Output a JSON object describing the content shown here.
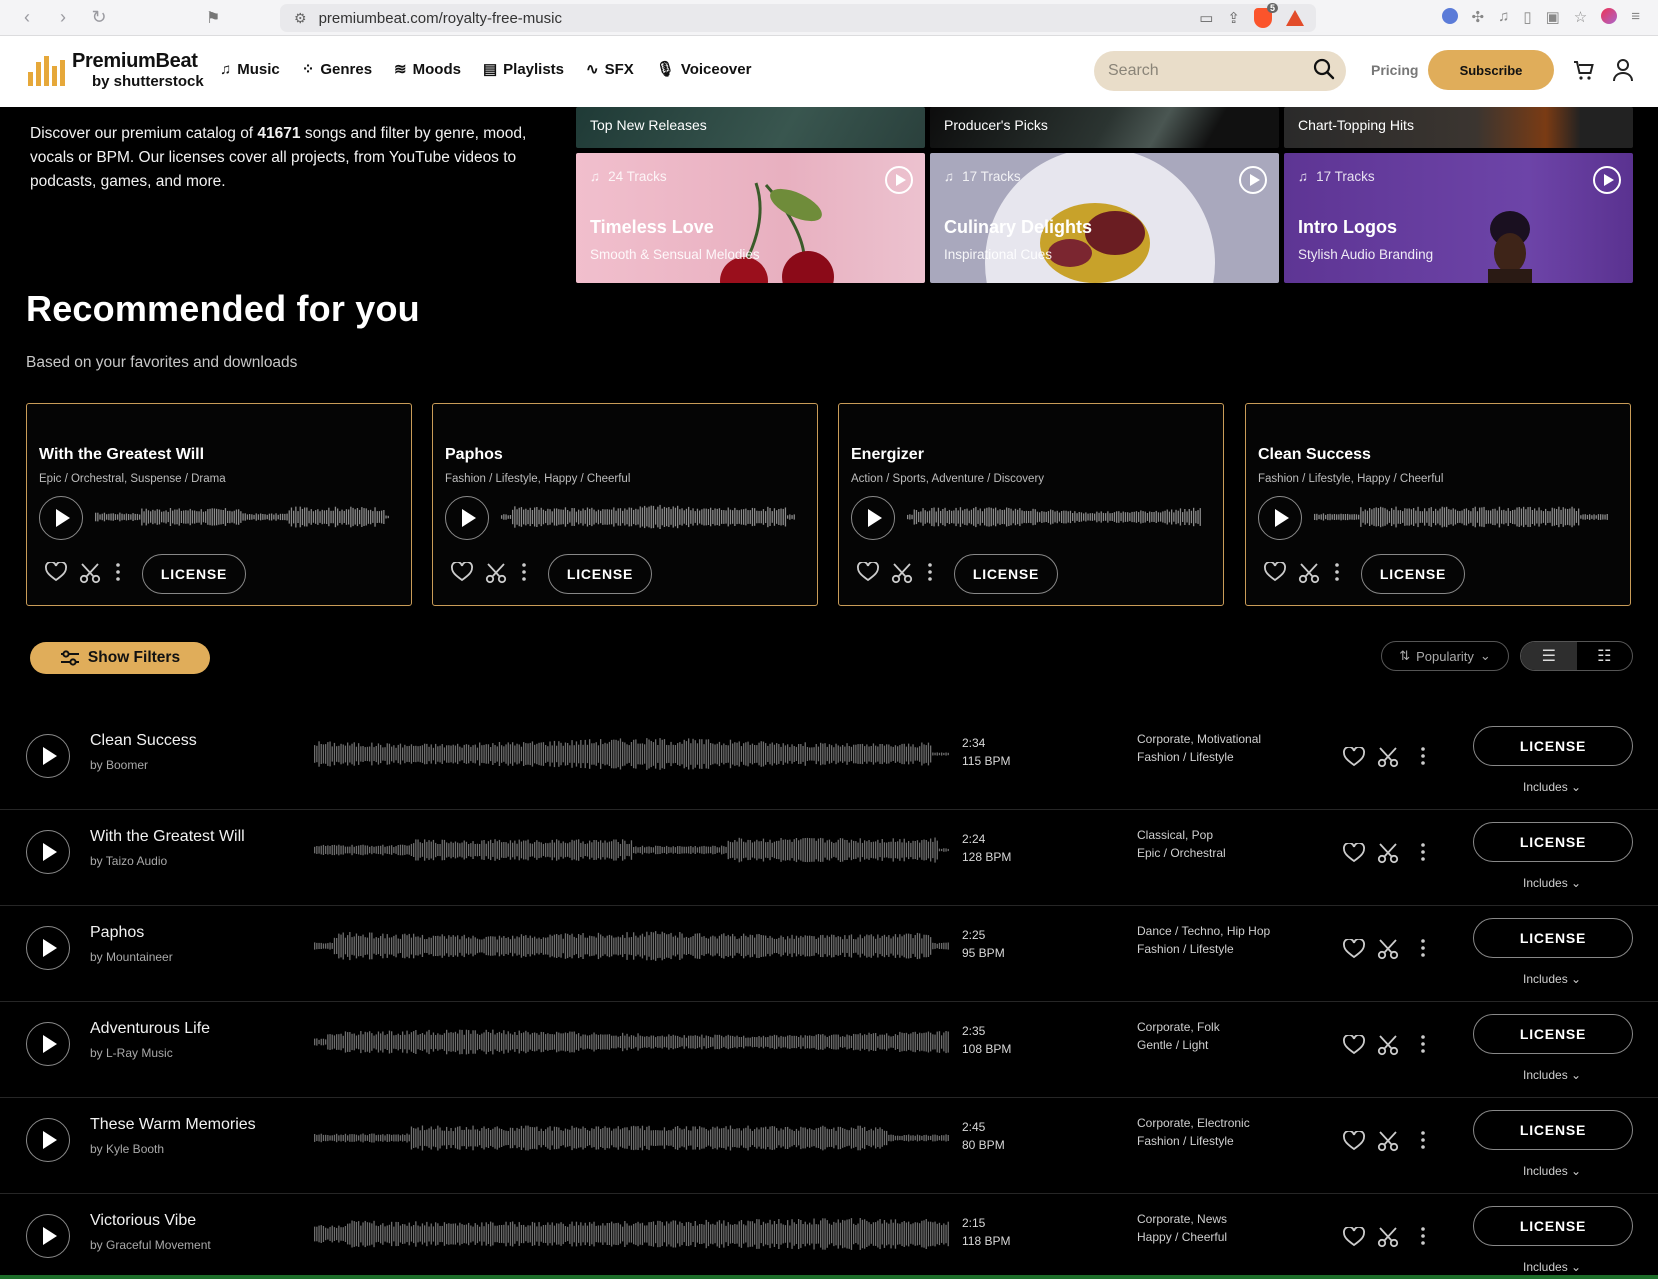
{
  "browser": {
    "url": "premiumbeat.com/royalty-free-music",
    "ext_badge": "5"
  },
  "header": {
    "logo_line1": "PremiumBeat",
    "logo_line2": "by shutterstock",
    "nav": [
      {
        "label": "Music",
        "icon": "music-note-icon"
      },
      {
        "label": "Genres",
        "icon": "grid-icon"
      },
      {
        "label": "Moods",
        "icon": "waves-icon"
      },
      {
        "label": "Playlists",
        "icon": "playlist-icon"
      },
      {
        "label": "SFX",
        "icon": "pulse-icon"
      },
      {
        "label": "Voiceover",
        "icon": "microphone-icon"
      }
    ],
    "search_placeholder": "Search",
    "pricing": "Pricing",
    "subscribe": "Subscribe"
  },
  "intro": {
    "before": "Discover our premium catalog of ",
    "count": "41671",
    "after": " songs and filter by genre, mood, vocals or BPM. Our licenses cover all projects, from YouTube videos to podcasts, games, and more."
  },
  "playlists": {
    "top_row": [
      "Top New Releases",
      "Producer's Picks",
      "Chart-Topping Hits"
    ],
    "tiles": [
      {
        "count": "24 Tracks",
        "title": "Timeless Love",
        "subtitle": "Smooth & Sensual Melodies",
        "color": "#e9b8c6"
      },
      {
        "count": "17 Tracks",
        "title": "Culinary Delights",
        "subtitle": "Inspirational Cues",
        "color": "#b6b5c9"
      },
      {
        "count": "17 Tracks",
        "title": "Intro Logos",
        "subtitle": "Stylish Audio Branding",
        "color": "#6a3ea0"
      }
    ]
  },
  "recommended": {
    "title": "Recommended for you",
    "subtitle": "Based on your favorites and downloads",
    "cards": [
      {
        "title": "With the Greatest Will",
        "genres": "Epic / Orchestral, Suspense / Drama",
        "license": "LICENSE"
      },
      {
        "title": "Paphos",
        "genres": "Fashion / Lifestyle, Happy / Cheerful",
        "license": "LICENSE"
      },
      {
        "title": "Energizer",
        "genres": "Action / Sports, Adventure / Discovery",
        "license": "LICENSE"
      },
      {
        "title": "Clean Success",
        "genres": "Fashion / Lifestyle, Happy / Cheerful",
        "license": "LICENSE"
      }
    ]
  },
  "filters": {
    "show_filters": "Show Filters",
    "sort": "Popularity"
  },
  "tracks": [
    {
      "title": "Clean Success",
      "artist": "by Boomer",
      "duration": "2:34",
      "bpm": "115 BPM",
      "genres1": "Corporate,  Motivational",
      "genres2": "Fashion / Lifestyle",
      "license": "LICENSE",
      "includes": "Includes"
    },
    {
      "title": "With the Greatest Will",
      "artist": "by Taizo Audio",
      "duration": "2:24",
      "bpm": "128 BPM",
      "genres1": "Classical,  Pop",
      "genres2": "Epic / Orchestral",
      "license": "LICENSE",
      "includes": "Includes"
    },
    {
      "title": "Paphos",
      "artist": "by Mountaineer",
      "duration": "2:25",
      "bpm": "95 BPM",
      "genres1": "Dance / Techno,  Hip Hop",
      "genres2": "Fashion / Lifestyle",
      "license": "LICENSE",
      "includes": "Includes"
    },
    {
      "title": "Adventurous Life",
      "artist": "by L-Ray Music",
      "duration": "2:35",
      "bpm": "108 BPM",
      "genres1": "Corporate,  Folk",
      "genres2": "Gentle / Light",
      "license": "LICENSE",
      "includes": "Includes"
    },
    {
      "title": "These Warm Memories",
      "artist": "by Kyle Booth",
      "duration": "2:45",
      "bpm": "80 BPM",
      "genres1": "Corporate,  Electronic",
      "genres2": "Fashion / Lifestyle",
      "license": "LICENSE",
      "includes": "Includes"
    },
    {
      "title": "Victorious Vibe",
      "artist": "by Graceful Movement",
      "duration": "2:15",
      "bpm": "118 BPM",
      "genres1": "Corporate,  News",
      "genres2": "Happy / Cheerful",
      "license": "LICENSE",
      "includes": "Includes"
    }
  ],
  "colors": {
    "accent": "#e0ad5a",
    "card_border": "#c99c58",
    "background": "#000000"
  }
}
